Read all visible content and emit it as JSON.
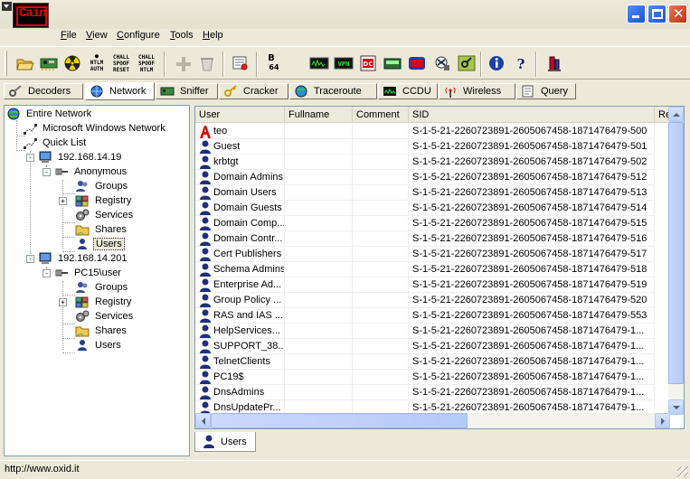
{
  "window": {
    "logo_text": "Cain",
    "controls": [
      "minimize-icon",
      "maximize-icon",
      "close-icon"
    ]
  },
  "menu": [
    "File",
    "View",
    "Configure",
    "Tools",
    "Help"
  ],
  "toolbar": {
    "buttons": [
      {
        "icon": "folder-open-icon"
      },
      {
        "icon": "network-card-icon"
      },
      {
        "icon": "radiation-icon"
      },
      {
        "icon": "ntlm-auth-icon",
        "text": [
          "NTLM",
          "AUTH"
        ]
      },
      {
        "icon": "chall-spoof-reset-icon",
        "text": [
          "CHALL",
          "SPOOF",
          "RESET"
        ]
      },
      {
        "icon": "chall-spoof-ntlm-icon",
        "text": [
          "CHALL",
          "SPOOF",
          "NTLM"
        ]
      },
      {
        "icon": "add-icon"
      },
      {
        "icon": "delete-icon"
      },
      {
        "icon": "certificate-icon"
      },
      {
        "icon": "base64-icon",
        "text": [
          "B",
          "64"
        ]
      },
      {
        "icon": "terminal-green-icon"
      },
      {
        "icon": "vpn-icon",
        "text": [
          "VPN"
        ]
      },
      {
        "icon": "pdf-icon"
      },
      {
        "icon": "calculator-icon"
      },
      {
        "icon": "red-box-icon"
      },
      {
        "icon": "hash-tool-icon"
      },
      {
        "icon": "key-tool-icon"
      },
      {
        "icon": "info-icon"
      },
      {
        "icon": "help-icon"
      },
      {
        "icon": "database-icon"
      }
    ]
  },
  "tabs": [
    {
      "label": "Decoders",
      "icon": "decoders-icon",
      "active": false
    },
    {
      "label": "Network",
      "icon": "network-icon",
      "active": true
    },
    {
      "label": "Sniffer",
      "icon": "sniffer-icon",
      "active": false
    },
    {
      "label": "Cracker",
      "icon": "cracker-icon",
      "active": false
    },
    {
      "label": "Traceroute",
      "icon": "traceroute-icon",
      "active": false
    },
    {
      "label": "CCDU",
      "icon": "ccdu-icon",
      "active": false
    },
    {
      "label": "Wireless",
      "icon": "wireless-icon",
      "active": false
    },
    {
      "label": "Query",
      "icon": "query-icon",
      "active": false
    }
  ],
  "tree": [
    {
      "label": "Entire Network",
      "icon": "globe-icon",
      "expander": ""
    },
    {
      "label": "Microsoft Windows Network",
      "icon": "network-node-icon",
      "expander": ""
    },
    {
      "label": "Quick List",
      "icon": "network-node-icon",
      "expander": ""
    },
    {
      "label": "192.168.14.19",
      "icon": "computer-icon",
      "expander": "-"
    },
    {
      "label": "Anonymous",
      "icon": "pipe-icon",
      "expander": "-"
    },
    {
      "label": "Groups",
      "icon": "groups-icon",
      "expander": ""
    },
    {
      "label": "Registry",
      "icon": "registry-icon",
      "expander": "+"
    },
    {
      "label": "Services",
      "icon": "services-icon",
      "expander": ""
    },
    {
      "label": "Shares",
      "icon": "shares-icon",
      "expander": ""
    },
    {
      "label": "Users",
      "icon": "users-icon",
      "expander": "",
      "selected": true
    },
    {
      "label": "192.168.14.201",
      "icon": "computer-icon",
      "expander": "-"
    },
    {
      "label": "PC15\\user",
      "icon": "pipe-icon",
      "expander": "-"
    },
    {
      "label": "Groups",
      "icon": "groups-icon",
      "expander": ""
    },
    {
      "label": "Registry",
      "icon": "registry-icon",
      "expander": "+"
    },
    {
      "label": "Services",
      "icon": "services-icon",
      "expander": ""
    },
    {
      "label": "Shares",
      "icon": "shares-icon",
      "expander": ""
    },
    {
      "label": "Users",
      "icon": "users-icon",
      "expander": ""
    }
  ],
  "list": {
    "columns": [
      "User",
      "Fullname",
      "Comment",
      "SID",
      "Re"
    ],
    "rows": [
      {
        "user": "teo",
        "icon": "admin-user-icon",
        "fullname": "",
        "comment": "",
        "sid": "S-1-5-21-2260723891-2605067458-1871476479-500"
      },
      {
        "user": "Guest",
        "icon": "user-icon",
        "fullname": "",
        "comment": "",
        "sid": "S-1-5-21-2260723891-2605067458-1871476479-501"
      },
      {
        "user": "krbtgt",
        "icon": "user-icon",
        "fullname": "",
        "comment": "",
        "sid": "S-1-5-21-2260723891-2605067458-1871476479-502"
      },
      {
        "user": "Domain Admins",
        "icon": "user-icon",
        "fullname": "",
        "comment": "",
        "sid": "S-1-5-21-2260723891-2605067458-1871476479-512"
      },
      {
        "user": "Domain Users",
        "icon": "user-icon",
        "fullname": "",
        "comment": "",
        "sid": "S-1-5-21-2260723891-2605067458-1871476479-513"
      },
      {
        "user": "Domain Guests",
        "icon": "user-icon",
        "fullname": "",
        "comment": "",
        "sid": "S-1-5-21-2260723891-2605067458-1871476479-514"
      },
      {
        "user": "Domain Comp...",
        "icon": "user-icon",
        "fullname": "",
        "comment": "",
        "sid": "S-1-5-21-2260723891-2605067458-1871476479-515"
      },
      {
        "user": "Domain Contr...",
        "icon": "user-icon",
        "fullname": "",
        "comment": "",
        "sid": "S-1-5-21-2260723891-2605067458-1871476479-516"
      },
      {
        "user": "Cert Publishers",
        "icon": "user-icon",
        "fullname": "",
        "comment": "",
        "sid": "S-1-5-21-2260723891-2605067458-1871476479-517"
      },
      {
        "user": "Schema Admins",
        "icon": "user-icon",
        "fullname": "",
        "comment": "",
        "sid": "S-1-5-21-2260723891-2605067458-1871476479-518"
      },
      {
        "user": "Enterprise Ad...",
        "icon": "user-icon",
        "fullname": "",
        "comment": "",
        "sid": "S-1-5-21-2260723891-2605067458-1871476479-519"
      },
      {
        "user": "Group Policy ...",
        "icon": "user-icon",
        "fullname": "",
        "comment": "",
        "sid": "S-1-5-21-2260723891-2605067458-1871476479-520"
      },
      {
        "user": "RAS and IAS ...",
        "icon": "user-icon",
        "fullname": "",
        "comment": "",
        "sid": "S-1-5-21-2260723891-2605067458-1871476479-553"
      },
      {
        "user": "HelpServices...",
        "icon": "user-icon",
        "fullname": "",
        "comment": "",
        "sid": "S-1-5-21-2260723891-2605067458-1871476479-1..."
      },
      {
        "user": "SUPPORT_38...",
        "icon": "user-icon",
        "fullname": "",
        "comment": "",
        "sid": "S-1-5-21-2260723891-2605067458-1871476479-1..."
      },
      {
        "user": "TelnetClients",
        "icon": "user-icon",
        "fullname": "",
        "comment": "",
        "sid": "S-1-5-21-2260723891-2605067458-1871476479-1..."
      },
      {
        "user": "PC19$",
        "icon": "user-icon",
        "fullname": "",
        "comment": "",
        "sid": "S-1-5-21-2260723891-2605067458-1871476479-1..."
      },
      {
        "user": "DnsAdmins",
        "icon": "user-icon",
        "fullname": "",
        "comment": "",
        "sid": "S-1-5-21-2260723891-2605067458-1871476479-1..."
      },
      {
        "user": "DnsUpdatePr...",
        "icon": "user-icon",
        "fullname": "",
        "comment": "",
        "sid": "S-1-5-21-2260723891-2605067458-1871476479-1..."
      }
    ]
  },
  "bottom_tab": {
    "label": "Users",
    "icon": "user-icon"
  },
  "status": {
    "text": "http://www.oxid.it"
  },
  "colors": {
    "accent": "#e00000",
    "xp_blue": "#1c53d9",
    "face": "#ece9d8"
  }
}
